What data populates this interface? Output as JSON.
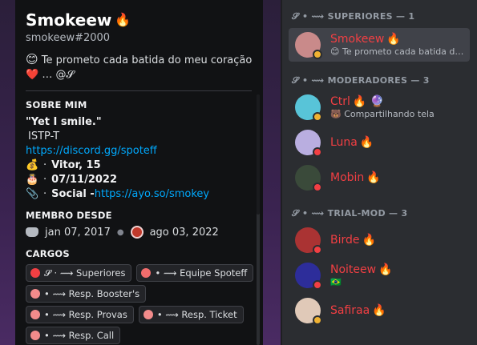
{
  "profile": {
    "display_name": "Smokeew",
    "name_emoji": "🔥",
    "username": "smokeew#2000",
    "status_text": "Te prometo cada batida do meu coração",
    "status_text2": "… @𝓢",
    "status_emoji": "😊",
    "heart": "❤️",
    "about_title": "SOBRE MIM",
    "about_quote": "\"Yet I smile.\"",
    "about_mbti": "ISTP-T",
    "about_link": "https://discord.gg/spoteff",
    "about_rows": [
      {
        "icon": "💰",
        "sep": "·",
        "label": "Vitor, 15"
      },
      {
        "icon": "🎂",
        "sep": "·",
        "label": "07/11/2022"
      },
      {
        "icon": "📎",
        "sep": "·",
        "label": "Social - ",
        "link": "https://ayo.so/smokey"
      }
    ],
    "member_since_title": "MEMBRO DESDE",
    "discord_date": "jan 07, 2017",
    "server_date": "ago 03, 2022",
    "roles_title": "CARGOS",
    "roles": [
      {
        "label": "𝓢 · ⟿ Superiores",
        "color": "#f23f43"
      },
      {
        "label": "• ⟿ Equipe Spoteff",
        "color": "#f26d6d"
      },
      {
        "label": "• ⟿ Resp. Booster's",
        "color": "#f28b8b"
      },
      {
        "label": "• ⟿ Resp. Provas",
        "color": "#f28b8b"
      },
      {
        "label": "• ⟿ Resp. Ticket",
        "color": "#f28b8b"
      },
      {
        "label": "• ⟿ Resp. Call",
        "color": "#f28b8b"
      }
    ]
  },
  "members": {
    "groups": [
      {
        "title": "𝓢 • ⟿ SUPERIORES — 1",
        "items": [
          {
            "name": "Smokeew",
            "emoji": "🔥",
            "sub": "😊 Te prometo cada batida do ...",
            "status": "idle",
            "avatar_color": "#c98a8a",
            "selected": true
          }
        ]
      },
      {
        "title": "𝓢 • ⟿ MODERADORES — 3",
        "items": [
          {
            "name": "Ctrl",
            "emoji": "🔥 🔮",
            "sub": "🐻 Compartilhando tela",
            "status": "idle",
            "avatar_color": "#58c4d8"
          },
          {
            "name": "Luna",
            "emoji": "🔥",
            "sub": "",
            "status": "dnd",
            "avatar_color": "#b9aee0"
          },
          {
            "name": "Mobin",
            "emoji": "🔥",
            "sub": "",
            "status": "dnd",
            "avatar_color": "#3a4a3a"
          }
        ]
      },
      {
        "title": "𝓢 • ⟿ TRIAL-MOD — 3",
        "items": [
          {
            "name": "Birde",
            "emoji": "🔥",
            "sub": "",
            "status": "dnd",
            "avatar_color": "#a33"
          },
          {
            "name": "Noiteew",
            "emoji": "🔥",
            "sub": "🇧🇷",
            "status": "dnd",
            "avatar_color": "#2d2d9a"
          },
          {
            "name": "Safiraa",
            "emoji": "🔥",
            "sub": "",
            "status": "idle",
            "avatar_color": "#e0c9b8"
          }
        ]
      }
    ]
  }
}
